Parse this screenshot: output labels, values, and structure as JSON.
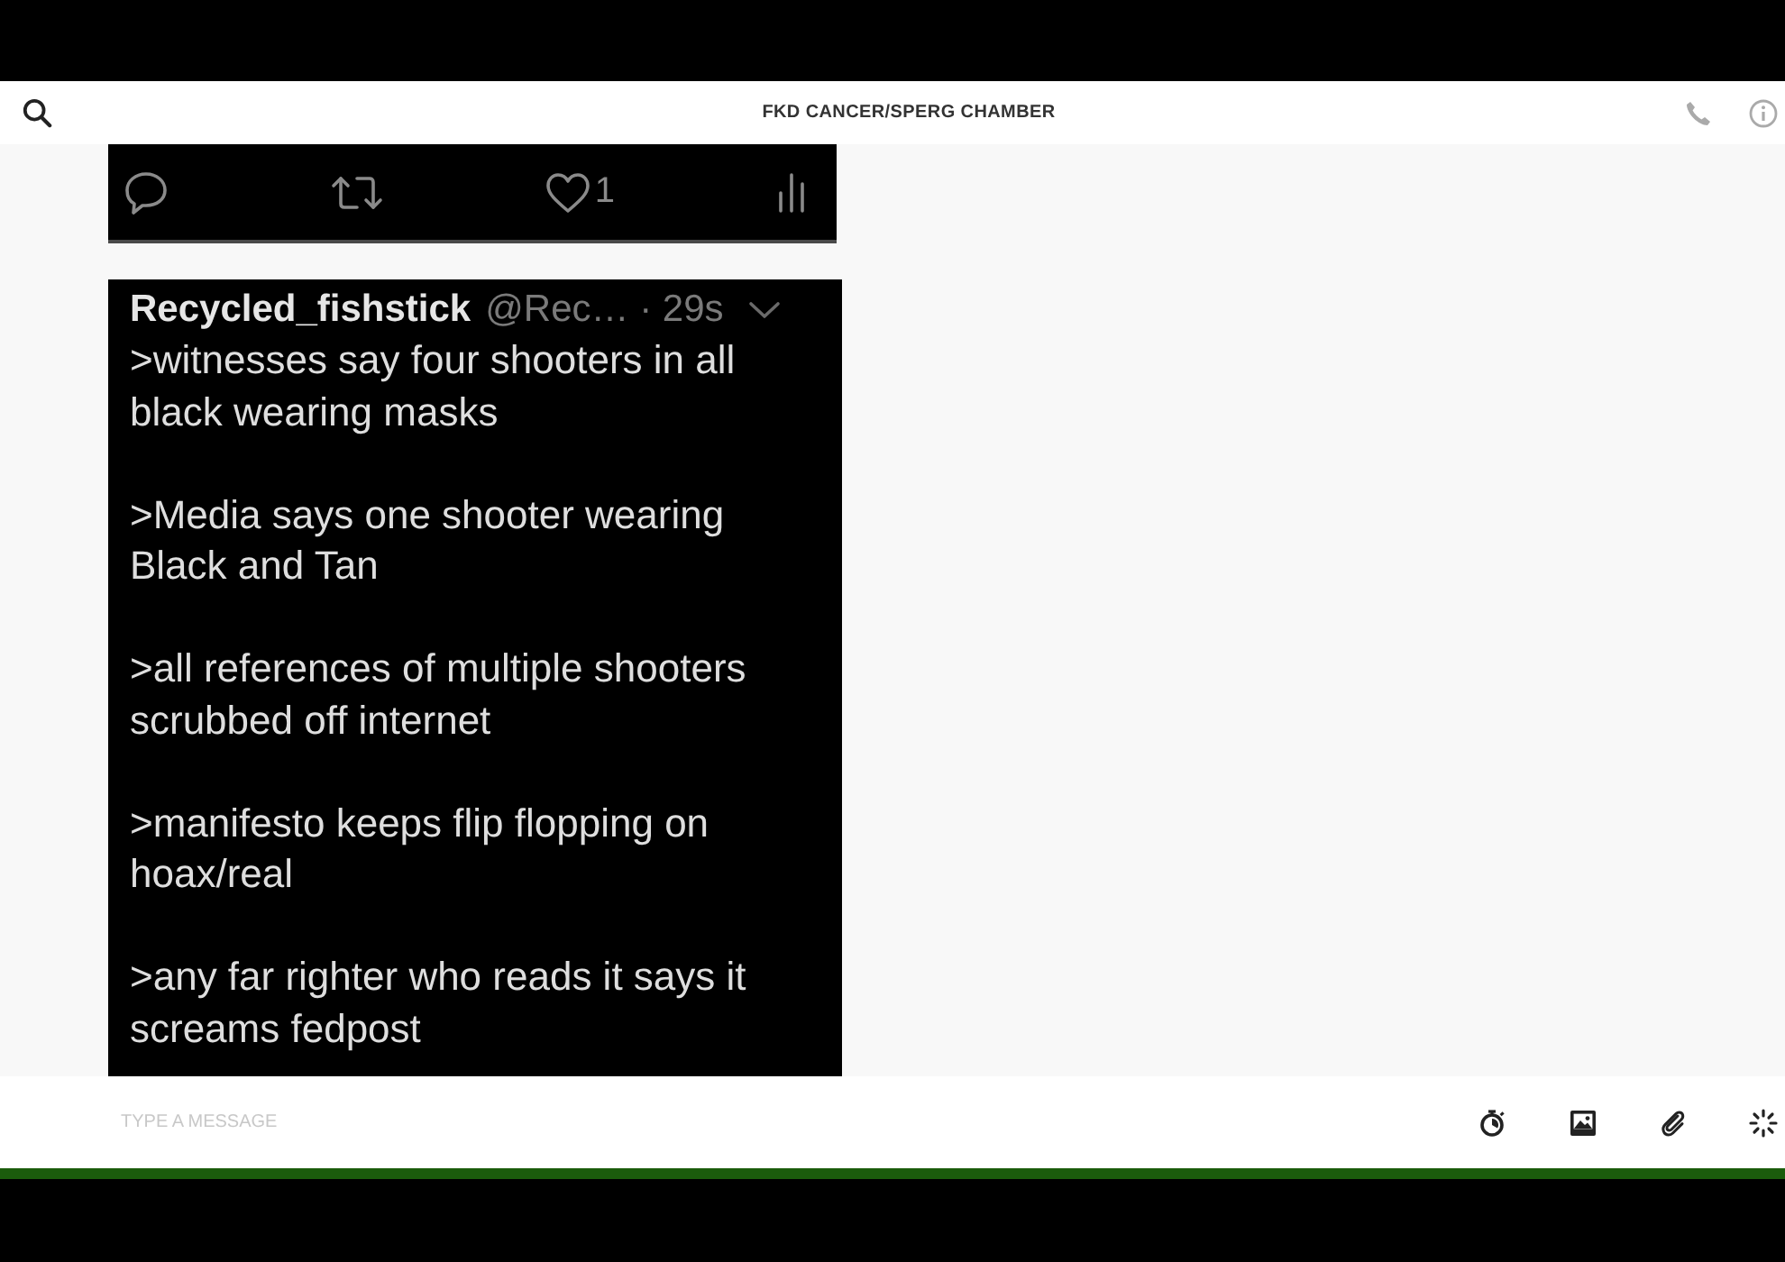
{
  "header": {
    "title": "FKD CANCER/SPERG CHAMBER"
  },
  "posts": [
    {
      "kind": "actions",
      "like_count": "1"
    },
    {
      "kind": "tweet",
      "author": "Recycled_fishstick",
      "meta": "@Rec… · 29s",
      "paragraphs": [
        ">witnesses say four shooters in all black wearing masks",
        ">Media says one shooter wearing Black and Tan",
        ">all references of multiple shooters scrubbed off internet",
        ">manifesto keeps flip flopping on hoax/real",
        ">any far righter who reads it says it screams fedpost"
      ]
    }
  ],
  "composer": {
    "placeholder": "TYPE A MESSAGE"
  }
}
